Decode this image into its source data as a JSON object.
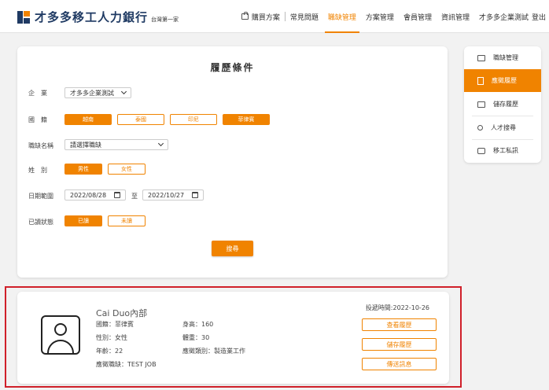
{
  "header": {
    "brand": "才多多移工人力銀行",
    "brand_sub": "台灣第一家",
    "nav": {
      "purchase": "購買方案",
      "faq": "常見問題",
      "jobs": "職缺管理",
      "plans": "方案管理",
      "members": "會員管理",
      "info": "資訊管理",
      "company": "才多多企業測試",
      "logout": "登出"
    }
  },
  "filter": {
    "title": "履歷條件",
    "company_label": "企　業",
    "company_value": "才多多企業測試",
    "nationality_label": "國　籍",
    "nationalities": [
      "越南",
      "泰國",
      "印尼",
      "菲律賓"
    ],
    "job_label": "職缺名稱",
    "job_placeholder": "請選擇職缺",
    "gender_label": "姓　別",
    "genders": [
      "男性",
      "女性"
    ],
    "date_label": "日期範圍",
    "date_from": "2022/08/28",
    "date_sep": "至",
    "date_to": "2022/10/27",
    "read_label": "已讀狀態",
    "read_states": [
      "已讀",
      "未讀"
    ],
    "search_button": "搜尋"
  },
  "side_menu": {
    "items": [
      "職缺管理",
      "應徵履歷",
      "儲存履歷",
      "人才搜尋",
      "移工私訊"
    ]
  },
  "result": {
    "name": "Cai Duo內部",
    "nationality": "國籍：菲律賓",
    "gender": "性別：女性",
    "age": "年齡：22",
    "applied_job": "應徵職缺：TEST JOB",
    "height": "身高：160",
    "weight": "體重：30",
    "category": "應徵類別：製造業工作",
    "posted": "投遞時間:2022-10-26",
    "buttons": {
      "view": "查看履歷",
      "save": "儲存履歷",
      "message": "傳送訊息"
    }
  },
  "colors": {
    "accent": "#f08300",
    "brand_navy": "#1f3a63",
    "highlight_border": "#d0202a"
  }
}
